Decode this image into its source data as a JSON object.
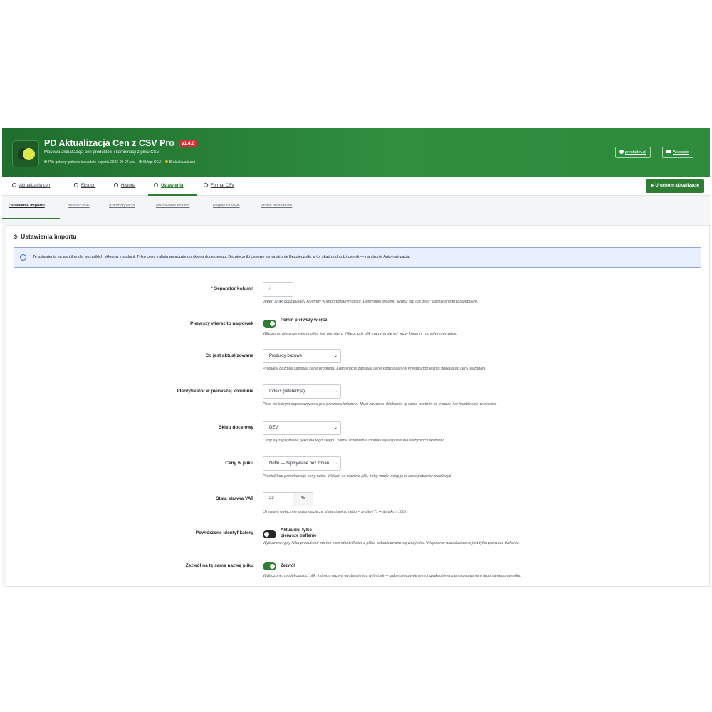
{
  "header": {
    "title": "PD Aktualizacja Cen z CSV Pro",
    "version": "v1.4.0",
    "subtitle": "Masowa aktualizacja cen produktów i kombinacji z pliku CSV",
    "status_file": "Plik gotowy: pdcsvpriceupdate-exports-2026-09-07.csv",
    "status_shop": "Sklep: DEV",
    "status_update": "Brak aktualizacji",
    "link_site": "prestadev.pl",
    "link_support": "Wsparcie"
  },
  "tabs": {
    "update": "Aktualizacja cen",
    "export": "Eksport",
    "history": "Historia",
    "settings": "Ustawienia",
    "csv_format": "Format CSV",
    "run_button": "▶ Uruchom aktualizację"
  },
  "subtabs": {
    "import_settings": "Ustawienia importu",
    "safeguards": "Bezpieczniki",
    "automation": "Automatyzacja",
    "column_mapping": "Mapowanie kolumn",
    "price_rules": "Reguły cenowe",
    "supplier_profiles": "Profile dostawców"
  },
  "panel": {
    "title": "Ustawienia importu",
    "info": "Te ustawienia są wspólne dla wszystkich sklepów instalacji. Tylko ceny trafiają wyłącznie do sklepu docelowego. Bezpieczniki cenowe są na stronie Bezpieczniki, a to, skąd pochodzi cennik — na stronie Automatyzacja."
  },
  "fields": {
    "separator": {
      "label": "Separator kolumn",
      "required_mark": "*",
      "value": ";",
      "help": "Jeden znak oddzielający kolumny w importowanym pliku. Domyślnie średnik. Wpisz tab dla pliku rozdzielanego tabulatorem."
    },
    "header_row": {
      "label": "Pierwszy wiersz to nagłówek",
      "toggle_label": "Pomiń pierwszy wiersz",
      "enabled": true,
      "help": "Włączone: pierwszy wiersz pliku jest pomijany. Włącz, gdy plik zaczyna się od nazw kolumn, np. reference;price."
    },
    "update_target": {
      "label": "Co jest aktualizowane",
      "value": "Produkty bazowe",
      "help": "Produkty bazowe zapisują cenę produktu. Kombinacje zapisują cenę kombinacji (w PrestaShop jest to dopłata do ceny bazowej)."
    },
    "identifier": {
      "label": "Identyfikator w pierwszej kolumnie",
      "value": "Indeks (referencja)",
      "help": "Pole, po którym dopasowywana jest pierwsza kolumna. Musi zawierać dokładnie tę samą wartość co produkt lub kombinacja w sklepie."
    },
    "target_shop": {
      "label": "Sklep docelowy",
      "value": "DEV",
      "help": "Ceny są zapisywane tylko dla tego sklepu. Same ustawienia modułu są wspólne dla wszystkich sklepów."
    },
    "prices_in_file": {
      "label": "Ceny w pliku",
      "value": "Netto — zapisywane bez zmian",
      "help": "PrestaShop przechowuje ceny netto. Wskaż, co zawiera plik, żeby moduł mógł je w razie potrzeby przeliczyć."
    },
    "vat_rate": {
      "label": "Stała stawka VAT",
      "value": "23",
      "unit": "%",
      "help": "Używana wyłącznie przez opcję ze stałą stawką: netto = brutto / (1 + stawka / 100)."
    },
    "duplicate_ids": {
      "label": "Powtórzone identyfikatory",
      "toggle_label": "Aktualizuj tylko pierwsze trafienie",
      "enabled": false,
      "help": "Wyłączone: gdy kilka produktów ma ten sam identyfikator z pliku, aktualizowane są wszystkie. Włączone: aktualizowane jest tylko pierwsze trafienie."
    },
    "same_name": {
      "label": "Zezwól na tę samą nazwę pliku",
      "toggle_label": "Zezwól",
      "enabled": true,
      "help": "Wyłączone: moduł odrzuci plik, którego nazwa występuje już w historii — zabezpieczenie przed dwukrotnym zaimportowaniem tego samego cennika."
    }
  },
  "colors": {
    "brand_green": "#2e7d32",
    "header_gradient_start": "#1f6e2e",
    "version_badge": "#d92b3a",
    "info_bg": "#e8efff",
    "info_border": "#8fa8d9"
  },
  "icons": {
    "logo": "module-logo",
    "info": "info-circle-icon",
    "gear": "gears-icon",
    "site": "globe-icon",
    "support": "envelope-icon"
  }
}
